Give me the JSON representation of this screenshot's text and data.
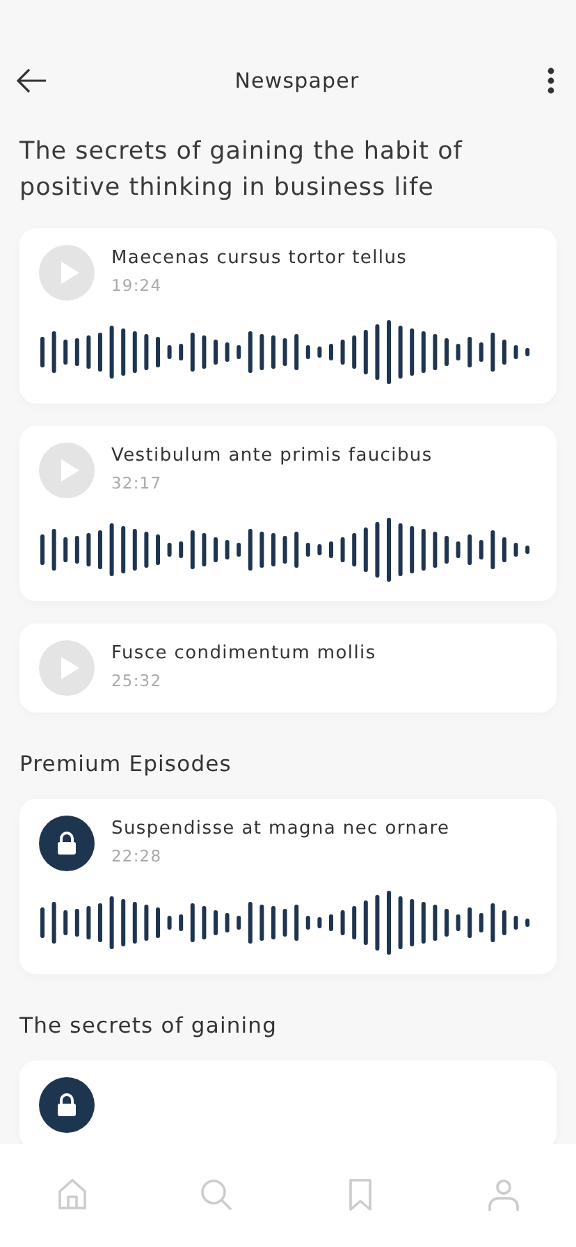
{
  "header": {
    "title": "Newspaper"
  },
  "headline": "The secrets of gaining the habit of positive thinking in business life",
  "sections": [
    {
      "episodes": [
        {
          "kind": "play",
          "title": "Maecenas cursus tortor tellus",
          "duration": "19:24",
          "waveform": true
        },
        {
          "kind": "play",
          "title": "Vestibulum ante primis faucibus",
          "duration": "32:17",
          "waveform": true
        },
        {
          "kind": "play",
          "title": "Fusce condimentum mollis",
          "duration": "25:32",
          "waveform": false
        }
      ]
    },
    {
      "heading": "Premium Episodes",
      "episodes": [
        {
          "kind": "locked",
          "title": "Suspendisse at magna nec ornare",
          "duration": "22:28",
          "waveform": true
        }
      ]
    },
    {
      "heading": "The secrets of gaining",
      "episodes": [
        {
          "kind": "locked",
          "waveform": false
        }
      ]
    }
  ],
  "nav": [
    {
      "kind": "home"
    },
    {
      "kind": "search"
    },
    {
      "kind": "bookmark"
    },
    {
      "kind": "profile"
    }
  ]
}
